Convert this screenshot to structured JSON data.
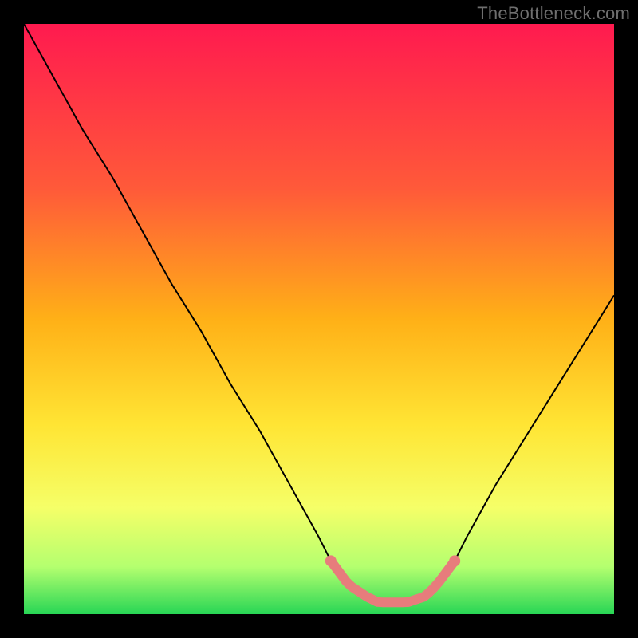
{
  "watermark": "TheBottleneck.com",
  "chart_data": {
    "type": "line",
    "title": "",
    "xlabel": "",
    "ylabel": "",
    "xlim": [
      0,
      100
    ],
    "ylim": [
      0,
      100
    ],
    "grid": false,
    "legend": false,
    "x": [
      0,
      5,
      10,
      15,
      20,
      25,
      30,
      35,
      40,
      45,
      50,
      52,
      55,
      58,
      60,
      63,
      65,
      68,
      70,
      73,
      75,
      80,
      85,
      90,
      95,
      100
    ],
    "values": [
      100,
      91,
      82,
      74,
      65,
      56,
      48,
      39,
      31,
      22,
      13,
      9,
      5,
      3,
      2,
      2,
      2,
      3,
      5,
      9,
      13,
      22,
      30,
      38,
      46,
      54
    ],
    "highlight_range": {
      "x_start": 52,
      "x_end": 73
    }
  },
  "colors": {
    "gradient": [
      "#ff1a4f",
      "#ff8a2b",
      "#ffe534",
      "#e8ff73",
      "#32dc5a"
    ],
    "curve": "#000000",
    "marker": "#e77c7c",
    "background": "#000000",
    "watermark": "#6f6f6f"
  }
}
